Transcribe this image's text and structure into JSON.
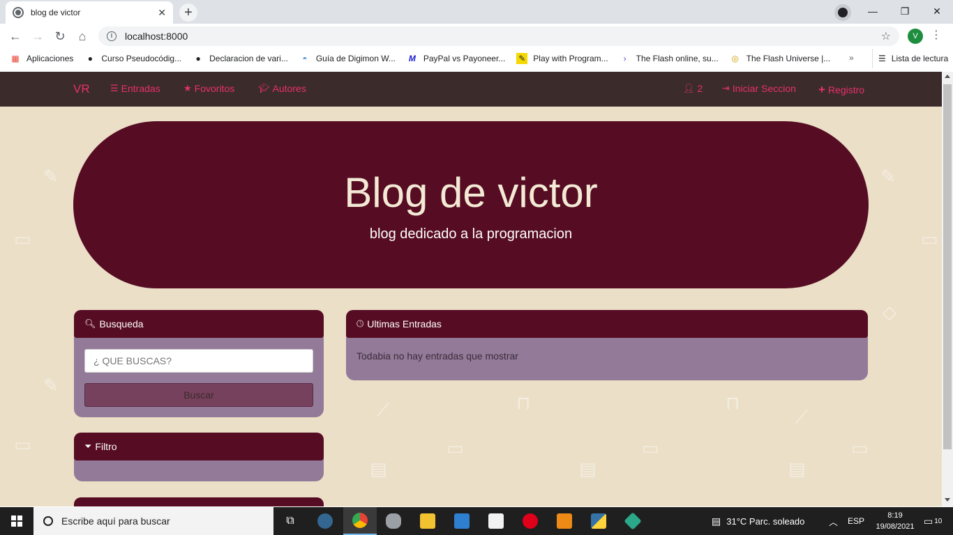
{
  "browser": {
    "tab_title": "blog de victor",
    "url": "localhost:8000",
    "profile_initial": "V",
    "bookmarks": [
      {
        "label": "Aplicaciones",
        "icon": "apps-grid-icon"
      },
      {
        "label": "Curso Pseudocódig...",
        "icon": "github-icon"
      },
      {
        "label": "Declaracion de vari...",
        "icon": "github-icon"
      },
      {
        "label": "Guía de Digimon W...",
        "icon": "digimon-icon"
      },
      {
        "label": "PayPal vs Payoneer...",
        "icon": "m-logo-icon"
      },
      {
        "label": "Play with Program...",
        "icon": "pencil-logo-icon"
      },
      {
        "label": "The Flash online, su...",
        "icon": "chevron-logo-icon"
      },
      {
        "label": "The Flash Universe |...",
        "icon": "compass-icon"
      }
    ],
    "reading_list": "Lista de lectura"
  },
  "navbar": {
    "brand": "VR",
    "entradas": "Entradas",
    "favoritos": "Fovoritos",
    "autores": "Autores",
    "user_count": "2",
    "login": "Iniciar Seccion",
    "register": "Registro"
  },
  "hero": {
    "title": "Blog de victor",
    "subtitle": "blog dedicado a la programacion"
  },
  "search_panel": {
    "title": "Busqueda",
    "placeholder": "¿ QUE BUSCAS?",
    "button": "Buscar"
  },
  "filter_panel": {
    "title": "Filtro"
  },
  "latest_panel": {
    "title": "Ultimas Entradas",
    "empty_message": "Todabia no hay entradas que mostrar"
  },
  "taskbar": {
    "search_placeholder": "Escribe aquí para buscar",
    "weather": "31°C  Parc. soleado",
    "language": "ESP",
    "time": "8:19",
    "date": "19/08/2021",
    "notifications": "10"
  }
}
